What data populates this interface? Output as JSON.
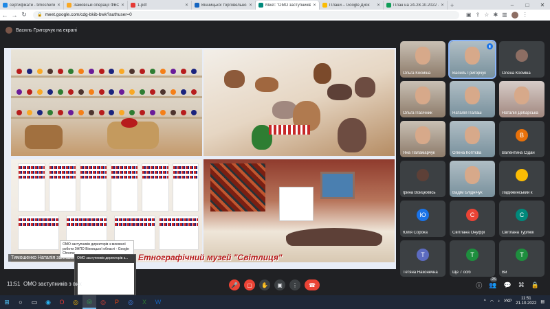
{
  "browser": {
    "tabs": [
      {
        "title": "сертифікати - timoshenko.nata",
        "fav": "#1e88e5",
        "active": false
      },
      {
        "title": "Замовські операції ФВС-13",
        "fav": "#f9a825",
        "active": false
      },
      {
        "title": "1.pdf",
        "fav": "#e53935",
        "active": false
      },
      {
        "title": "Вінницької торговельно-еко",
        "fav": "#1565c0",
        "active": false
      },
      {
        "title": "Meet: \"ОМО заступників з",
        "fav": "#00897b",
        "active": true
      },
      {
        "title": "Плани – Google Диск",
        "fav": "#fbbc04",
        "active": false
      },
      {
        "title": "План на 24-28.10.2022 - Goog",
        "fav": "#0f9d58",
        "active": false
      }
    ],
    "new_tab": "+",
    "url": "meet.google.com/cdg-bkib-bwk?authuser=0"
  },
  "meet": {
    "presenting_label": "Василь Григорчук на екрані",
    "stage_caption": "Етнографічний музей \"Світлиця\"",
    "stage_name_overlay": "Тимошенко Наталія залишає зу",
    "participants": [
      {
        "name": "Ольга Косміна",
        "type": "video"
      },
      {
        "name": "Василь Григорчук",
        "type": "video"
      },
      {
        "name": "Олена Косміна",
        "type": "avatar",
        "initial": "",
        "color": "#8d6e63"
      },
      {
        "name": "Ольга Пасічник",
        "type": "video"
      },
      {
        "name": "Наталія Палаш",
        "type": "video"
      },
      {
        "name": "Наталія Дебарська",
        "type": "video"
      },
      {
        "name": "Яна Паламарчук",
        "type": "video"
      },
      {
        "name": "Олена Коптєва",
        "type": "video"
      },
      {
        "name": "Валентина Сідан",
        "type": "avatar",
        "initial": "В",
        "color": "#e8710a"
      },
      {
        "name": "Ірина Войцехівсь",
        "type": "avatar",
        "initial": "",
        "color": "#5d4037"
      },
      {
        "name": "Вадім Бліднічук",
        "type": "video"
      },
      {
        "name": "Ладижинський к",
        "type": "avatar",
        "initial": "",
        "color": "#fbbc04"
      },
      {
        "name": "Юлія Сорока",
        "type": "avatar",
        "initial": "Ю",
        "color": "#1a73e8"
      },
      {
        "name": "Світлана Онуфрі",
        "type": "avatar",
        "initial": "С",
        "color": "#ea4335"
      },
      {
        "name": "Світлана Турлюк",
        "type": "avatar",
        "initial": "С",
        "color": "#00897b"
      },
      {
        "name": "Тетяна Наконечна",
        "type": "avatar",
        "initial": "Т",
        "color": "#5c6bc0"
      },
      {
        "name": "Ще 7 осіб",
        "type": "avatar",
        "initial": "Т",
        "color": "#1e8e3e"
      },
      {
        "name": "Ви",
        "type": "avatar",
        "initial": "Т",
        "color": "#1e8e3e"
      }
    ],
    "bottom": {
      "time": "11:51",
      "meeting_name": "ОМО заступників з вих",
      "participants_badge": "25"
    },
    "tooltip": "ОМО заступників директорів з виховної роботи ЗФПО Вінницької області - Google Chrome",
    "preview_title": "ОМО заступників директорів з..."
  },
  "taskbar": {
    "lang": "УКР",
    "time": "11:51",
    "date": "21.10.2022"
  }
}
